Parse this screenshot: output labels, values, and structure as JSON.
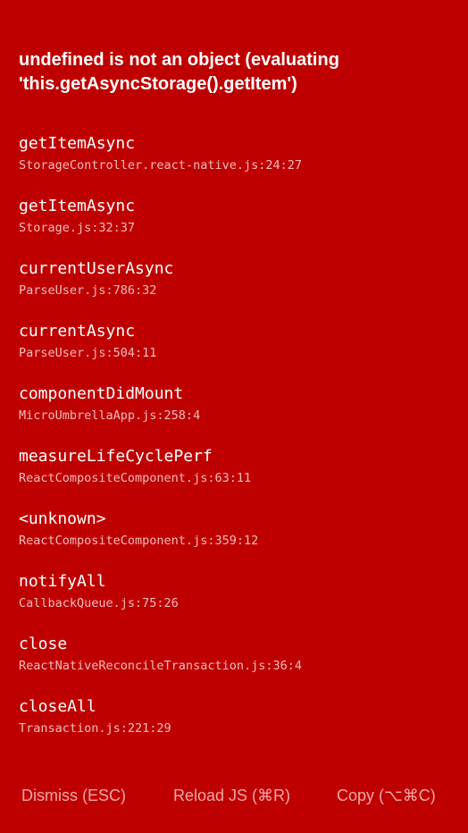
{
  "error": {
    "title": "undefined is not an object (evaluating 'this.getAsyncStorage().getItem')"
  },
  "stack": [
    {
      "method": "getItemAsync",
      "location": "StorageController.react-native.js:24:27"
    },
    {
      "method": "getItemAsync",
      "location": "Storage.js:32:37"
    },
    {
      "method": "currentUserAsync",
      "location": "ParseUser.js:786:32"
    },
    {
      "method": "currentAsync",
      "location": "ParseUser.js:504:11"
    },
    {
      "method": "componentDidMount",
      "location": "MicroUmbrellaApp.js:258:4"
    },
    {
      "method": "measureLifeCyclePerf",
      "location": "ReactCompositeComponent.js:63:11"
    },
    {
      "method": "<unknown>",
      "location": "ReactCompositeComponent.js:359:12"
    },
    {
      "method": "notifyAll",
      "location": "CallbackQueue.js:75:26"
    },
    {
      "method": "close",
      "location": "ReactNativeReconcileTransaction.js:36:4"
    },
    {
      "method": "closeAll",
      "location": "Transaction.js:221:29"
    }
  ],
  "buttons": {
    "dismiss_label": "Dismiss (ESC)",
    "reload_label": "Reload JS (⌘R)",
    "copy_label": "Copy (⌥⌘C)"
  },
  "colors": {
    "background": "#bf0000",
    "text": "#ffffff",
    "secondary_text": "#f0bcbc",
    "button_text": "#f0a6a6"
  }
}
